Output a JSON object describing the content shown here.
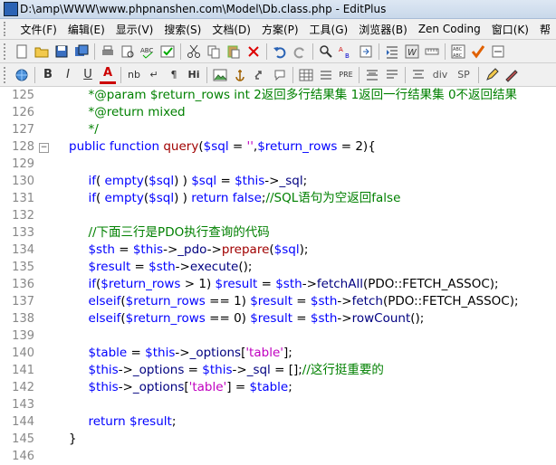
{
  "window": {
    "title": "D:\\amp\\WWW\\www.phpnanshen.com\\Model\\Db.class.php - EditPlus"
  },
  "menu": [
    "文件(F)",
    "编辑(E)",
    "显示(V)",
    "搜索(S)",
    "文档(D)",
    "方案(P)",
    "工具(G)",
    "浏览器(B)",
    "Zen Coding",
    "窗口(K)",
    "帮"
  ],
  "toolbar1": [
    "new-file-icon",
    "open-file-icon",
    "save-icon",
    "save-all-icon",
    "print-icon",
    "print-preview-icon",
    "spellcheck-icon",
    "browser-preview-icon",
    "cut-icon",
    "copy-icon",
    "paste-icon",
    "delete-icon",
    "undo-icon",
    "redo-icon",
    "find-icon",
    "replace-icon",
    "goto-icon",
    "indent-icon",
    "word-wrap-icon",
    "ruler-icon",
    "column-select-icon",
    "check-icon",
    "toggle-icon"
  ],
  "toolbar2": [
    "globe-icon",
    "bold-icon",
    "italic-icon",
    "underline-icon",
    "font-color-icon",
    "nbsp-icon",
    "br-icon",
    "paragraph-icon",
    "heading-icon",
    "image-icon",
    "anchor-icon",
    "link-icon",
    "comment-icon",
    "table-icon",
    "list-icon",
    "pre-icon",
    "quote-icon",
    "wrap-icon",
    "center-icon",
    "div-icon",
    "span-icon",
    "edit-icon",
    "style-icon"
  ],
  "toolbar2_labels": {
    "italic": "I",
    "underline": "U",
    "font_color": "A",
    "nb": "nb",
    "br": "↵",
    "para": "¶",
    "hi": "Hi",
    "pre": "PRE",
    "div": "div",
    "sp": "SP",
    "bold": "B"
  },
  "lines": [
    {
      "num": "125",
      "fold": "",
      "tokens": [
        [
          "c-comment",
          "    *@param $return_rows int 2返回多行结果集 1返回一行结果集 0不返回结果"
        ]
      ]
    },
    {
      "num": "126",
      "fold": "",
      "tokens": [
        [
          "c-comment",
          "    *@return mixed"
        ]
      ]
    },
    {
      "num": "127",
      "fold": "",
      "tokens": [
        [
          "c-comment",
          "    */"
        ]
      ]
    },
    {
      "num": "128",
      "fold": "⊟",
      "tokens": [
        [
          "c-kw",
          "public function "
        ],
        [
          "c-fn",
          "query"
        ],
        [
          "",
          "("
        ],
        [
          "c-var",
          "$sql"
        ],
        [
          "",
          " = "
        ],
        [
          "c-str",
          "''"
        ],
        [
          "",
          ","
        ],
        [
          "c-var",
          "$return_rows"
        ],
        [
          "",
          " = 2){"
        ]
      ]
    },
    {
      "num": "129",
      "fold": "",
      "tokens": [
        [
          "",
          ""
        ]
      ]
    },
    {
      "num": "130",
      "fold": "",
      "tokens": [
        [
          "c-kw",
          "    if"
        ],
        [
          "",
          "( "
        ],
        [
          "c-kw",
          "empty"
        ],
        [
          "",
          "("
        ],
        [
          "c-var",
          "$sql"
        ],
        [
          "",
          ") ) "
        ],
        [
          "c-var",
          "$sql"
        ],
        [
          "",
          " = "
        ],
        [
          "c-var",
          "$this"
        ],
        [
          "",
          "->"
        ],
        [
          "c-def",
          "_sql"
        ],
        [
          "",
          ";"
        ]
      ]
    },
    {
      "num": "131",
      "fold": "",
      "tokens": [
        [
          "c-kw",
          "    if"
        ],
        [
          "",
          "( "
        ],
        [
          "c-kw",
          "empty"
        ],
        [
          "",
          "("
        ],
        [
          "c-var",
          "$sql"
        ],
        [
          "",
          ") ) "
        ],
        [
          "c-kw",
          "return false"
        ],
        [
          "",
          ";"
        ],
        [
          "c-comment",
          "//SQL语句为空返回false"
        ]
      ]
    },
    {
      "num": "132",
      "fold": "",
      "tokens": [
        [
          "",
          ""
        ]
      ]
    },
    {
      "num": "133",
      "fold": "",
      "tokens": [
        [
          "c-comment",
          "    //下面三行是PDO执行查询的代码"
        ]
      ]
    },
    {
      "num": "134",
      "fold": "",
      "tokens": [
        [
          "c-var",
          "    $sth"
        ],
        [
          "",
          " = "
        ],
        [
          "c-var",
          "$this"
        ],
        [
          "",
          "->"
        ],
        [
          "c-def",
          "_pdo"
        ],
        [
          "",
          "->"
        ],
        [
          "c-fn",
          "prepare"
        ],
        [
          "",
          "("
        ],
        [
          "c-var",
          "$sql"
        ],
        [
          "",
          ");"
        ]
      ]
    },
    {
      "num": "135",
      "fold": "",
      "tokens": [
        [
          "c-var",
          "    $result"
        ],
        [
          "",
          " = "
        ],
        [
          "c-var",
          "$sth"
        ],
        [
          "",
          "->"
        ],
        [
          "c-def",
          "execute"
        ],
        [
          "",
          "();"
        ]
      ]
    },
    {
      "num": "136",
      "fold": "",
      "tokens": [
        [
          "c-kw",
          "    if"
        ],
        [
          "",
          "("
        ],
        [
          "c-var",
          "$return_rows"
        ],
        [
          "",
          " > 1) "
        ],
        [
          "c-var",
          "$result"
        ],
        [
          "",
          " = "
        ],
        [
          "c-var",
          "$sth"
        ],
        [
          "",
          "->"
        ],
        [
          "c-def",
          "fetchAll"
        ],
        [
          "",
          "(PDO::FETCH_ASSOC);"
        ]
      ]
    },
    {
      "num": "137",
      "fold": "",
      "tokens": [
        [
          "c-kw",
          "    elseif"
        ],
        [
          "",
          "("
        ],
        [
          "c-var",
          "$return_rows"
        ],
        [
          "",
          " == 1) "
        ],
        [
          "c-var",
          "$result"
        ],
        [
          "",
          " = "
        ],
        [
          "c-var",
          "$sth"
        ],
        [
          "",
          "->"
        ],
        [
          "c-def",
          "fetch"
        ],
        [
          "",
          "(PDO::FETCH_ASSOC);"
        ]
      ]
    },
    {
      "num": "138",
      "fold": "",
      "tokens": [
        [
          "c-kw",
          "    elseif"
        ],
        [
          "",
          "("
        ],
        [
          "c-var",
          "$return_rows"
        ],
        [
          "",
          " == 0) "
        ],
        [
          "c-var",
          "$result"
        ],
        [
          "",
          " = "
        ],
        [
          "c-var",
          "$sth"
        ],
        [
          "",
          "->"
        ],
        [
          "c-def",
          "rowCount"
        ],
        [
          "",
          "();"
        ]
      ]
    },
    {
      "num": "139",
      "fold": "",
      "tokens": [
        [
          "",
          ""
        ]
      ]
    },
    {
      "num": "140",
      "fold": "",
      "tokens": [
        [
          "c-var",
          "    $table"
        ],
        [
          "",
          " = "
        ],
        [
          "c-var",
          "$this"
        ],
        [
          "",
          "->"
        ],
        [
          "c-def",
          "_options"
        ],
        [
          "",
          "["
        ],
        [
          "c-str",
          "'table'"
        ],
        [
          "",
          "];"
        ]
      ]
    },
    {
      "num": "141",
      "fold": "",
      "tokens": [
        [
          "c-var",
          "    $this"
        ],
        [
          "",
          "->"
        ],
        [
          "c-def",
          "_options"
        ],
        [
          "",
          " = "
        ],
        [
          "c-var",
          "$this"
        ],
        [
          "",
          "->"
        ],
        [
          "c-def",
          "_sql"
        ],
        [
          "",
          " = [];"
        ],
        [
          "c-comment",
          "//这行挺重要的"
        ]
      ]
    },
    {
      "num": "142",
      "fold": "",
      "tokens": [
        [
          "c-var",
          "    $this"
        ],
        [
          "",
          "->"
        ],
        [
          "c-def",
          "_options"
        ],
        [
          "",
          "["
        ],
        [
          "c-str",
          "'table'"
        ],
        [
          "",
          "] = "
        ],
        [
          "c-var",
          "$table"
        ],
        [
          "",
          ";"
        ]
      ]
    },
    {
      "num": "143",
      "fold": "",
      "tokens": [
        [
          "",
          ""
        ]
      ]
    },
    {
      "num": "144",
      "fold": "",
      "tokens": [
        [
          "c-kw",
          "    return "
        ],
        [
          "c-var",
          "$result"
        ],
        [
          "",
          ";"
        ]
      ]
    },
    {
      "num": "145",
      "fold": "",
      "tokens": [
        [
          "",
          "}"
        ]
      ]
    },
    {
      "num": "146",
      "fold": "",
      "tokens": [
        [
          "",
          ""
        ]
      ]
    }
  ],
  "colors": {
    "comment": "#008000",
    "keyword": "#0000ff",
    "string": "#c000c0",
    "function": "#a00000"
  }
}
